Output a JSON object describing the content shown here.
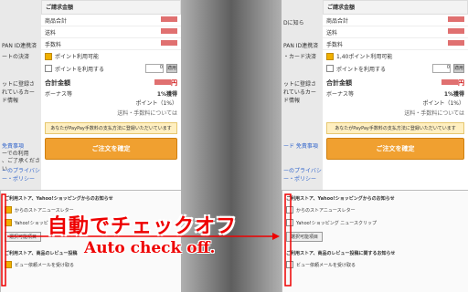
{
  "left": {
    "header": "ご請求金額",
    "rows": [
      {
        "label": "商品合計"
      },
      {
        "label": "送料"
      },
      {
        "label": "手数料"
      }
    ],
    "point_label": "ポイント利用可能",
    "use_point_label": "ポイントを利用する",
    "point_value": "0",
    "point_btn": "適用",
    "total_label": "合計金額",
    "total_suffix": "円",
    "bonus_label": "ボーナス等",
    "bonus_rate": "1%獲得",
    "bonus_points": "ポイント（1%）",
    "bonus_note": "送料・手数料については",
    "paypay_note": "あなたがPayPay手数料の支払方法に登録いただいています",
    "order_btn": "ご注文を確定",
    "side_texts": [
      "PAN ID連携済",
      "ートの決済",
      "ットに登録されているカード情報",
      "免責事項",
      "ーでの利用",
      "、ご了承ください",
      "ーのプライバシー・ポリシー"
    ],
    "notify_title": "ご利用ストア、Yahoo!ショッピングからのお知らせ",
    "notify_items": [
      "からのストアニュースレター",
      "Yahoo!ショッピング"
    ],
    "notify_btn": "選択可能項目",
    "review_title": "ご利用ストア、商品のレビュー投稿",
    "review_item": "ビュー依頼メールを受け取る"
  },
  "right": {
    "header": "ご請求金額",
    "rows": [
      {
        "label": "商品合計"
      },
      {
        "label": "送料"
      },
      {
        "label": "手数料"
      }
    ],
    "point_label": "1,40ポイント利用可能",
    "use_point_label": "ポイントを利用する",
    "point_value": "0",
    "point_btn": "適用",
    "total_label": "合計金額",
    "total_suffix": "円",
    "bonus_label": "ボーナス等",
    "bonus_rate": "1%獲得",
    "bonus_points": "ポイント（1%）",
    "bonus_note": "送料・手数料については",
    "paypay_note": "あなたがPayPay手数料の支払方法に登録いただいています",
    "order_btn": "ご注文を確定",
    "side_texts": [
      "Dに知ら",
      "PAN ID連携済",
      "・カード決済",
      "ットに登録されているカード情報",
      "ード 免責事項",
      "ーのプライバシー・ポリシー"
    ],
    "notify_title": "ご利用ストア、Yahoo!ショッピングからのお知らせ",
    "notify_items": [
      "からのストアニュースレター",
      "Yahoo!ショッピング ニュースクリップ"
    ],
    "notify_btn": "選択可能項目",
    "review_title": "ご利用ストア、商品のレビュー投稿に関するお知らせ",
    "review_item": "ビュー依頼メールを受け取る"
  },
  "overlay": {
    "jp": "自動でチェックオフ",
    "en": "Auto check off."
  },
  "colors": {
    "accent": "#f0a030",
    "red": "#e00000",
    "checked": "#f0b000"
  }
}
